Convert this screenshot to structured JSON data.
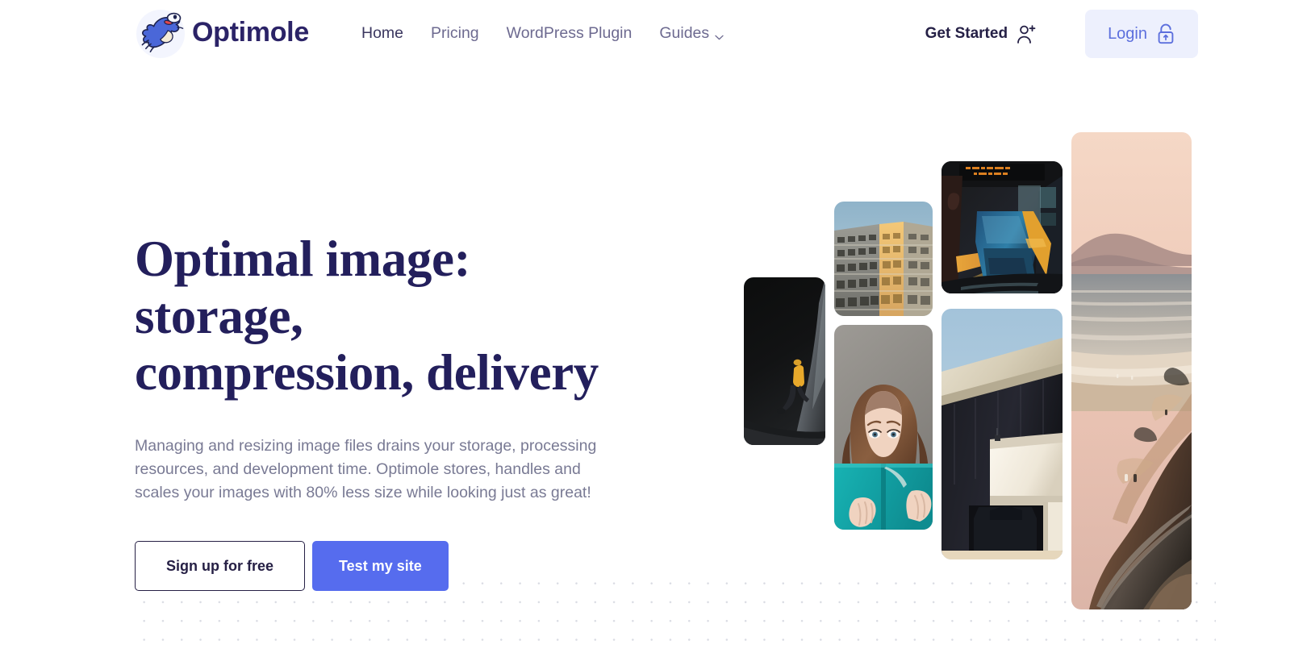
{
  "brand": {
    "name": "Optimole",
    "logo_icon": "optimole-mole-logo",
    "name_color": "#2b2367"
  },
  "header": {
    "nav": [
      {
        "label": "Home",
        "active": true,
        "icon": null
      },
      {
        "label": "Pricing",
        "active": false,
        "icon": null
      },
      {
        "label": "WordPress Plugin",
        "active": false,
        "icon": null
      },
      {
        "label": "Guides",
        "active": false,
        "icon": "chevron-down-icon"
      }
    ],
    "get_started": {
      "label": "Get Started",
      "icon": "user-plus-icon"
    },
    "login": {
      "label": "Login",
      "icon": "unlock-padlock-icon",
      "bg_color": "#edf0fd",
      "text_color": "#5c6fdd"
    }
  },
  "hero": {
    "title_line_1": "Optimal image: storage,",
    "title_line_2": "compression, delivery",
    "title_color": "#231f5c",
    "subtitle": "Managing and resizing image files drains your storage, processing resources, and development time. Optimole stores, handles and scales your images with 80% less size while looking just as great!",
    "subtitle_color": "#797a94",
    "buttons": {
      "secondary_label": "Sign up for free",
      "primary_label": "Test my site",
      "primary_color": "#566cee"
    }
  },
  "collage": {
    "images": [
      {
        "name": "cave-explorer-photo",
        "alt": "Person in yellow jacket walking inside a dark cave"
      },
      {
        "name": "building-facade-photo",
        "alt": "Apartment building facade seen from below with sunlit yellow wall"
      },
      {
        "name": "train-station-photo",
        "alt": "Blue train at a wet night-time station platform with an orange LED sign"
      },
      {
        "name": "woman-with-book-photo",
        "alt": "Woman holding a teal book over the lower half of her face"
      },
      {
        "name": "concrete-architecture-photo",
        "alt": "Modern concrete overpass and white building against a blue sky"
      },
      {
        "name": "coastal-cliff-photo",
        "alt": "Coastal cliff road at dusk with pink sky and ocean"
      }
    ]
  },
  "background": {
    "dot_pattern_color": "#d9dbe3"
  }
}
